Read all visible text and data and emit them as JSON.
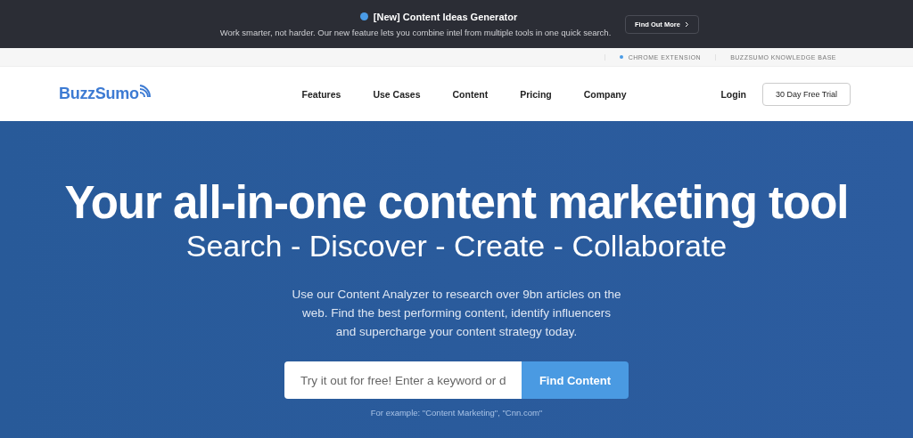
{
  "announcement": {
    "title": "[New] Content Ideas Generator",
    "text": "Work smarter, not harder. Our new feature lets you combine intel from multiple tools in one quick search.",
    "button": "Find Out More"
  },
  "utility_links": [
    "CHROME EXTENSION",
    "BUZZSUMO KNOWLEDGE BASE"
  ],
  "nav": {
    "logo": "BuzzSumo",
    "items": [
      "Features",
      "Use Cases",
      "Content",
      "Pricing",
      "Company"
    ],
    "login": "Login",
    "trial": "30 Day Free Trial"
  },
  "hero": {
    "title": "Your all-in-one content marketing tool",
    "subtitle": "Search - Discover - Create - Collaborate",
    "text": "Use our Content Analyzer to research over 9bn articles on the web. Find the best performing content, identify influencers and supercharge your content strategy today.",
    "search": {
      "placeholder": "Try it out for free! Enter a keyword or d",
      "button": "Find Content"
    },
    "example": "For example: \"Content Marketing\", \"Cnn.com\""
  }
}
